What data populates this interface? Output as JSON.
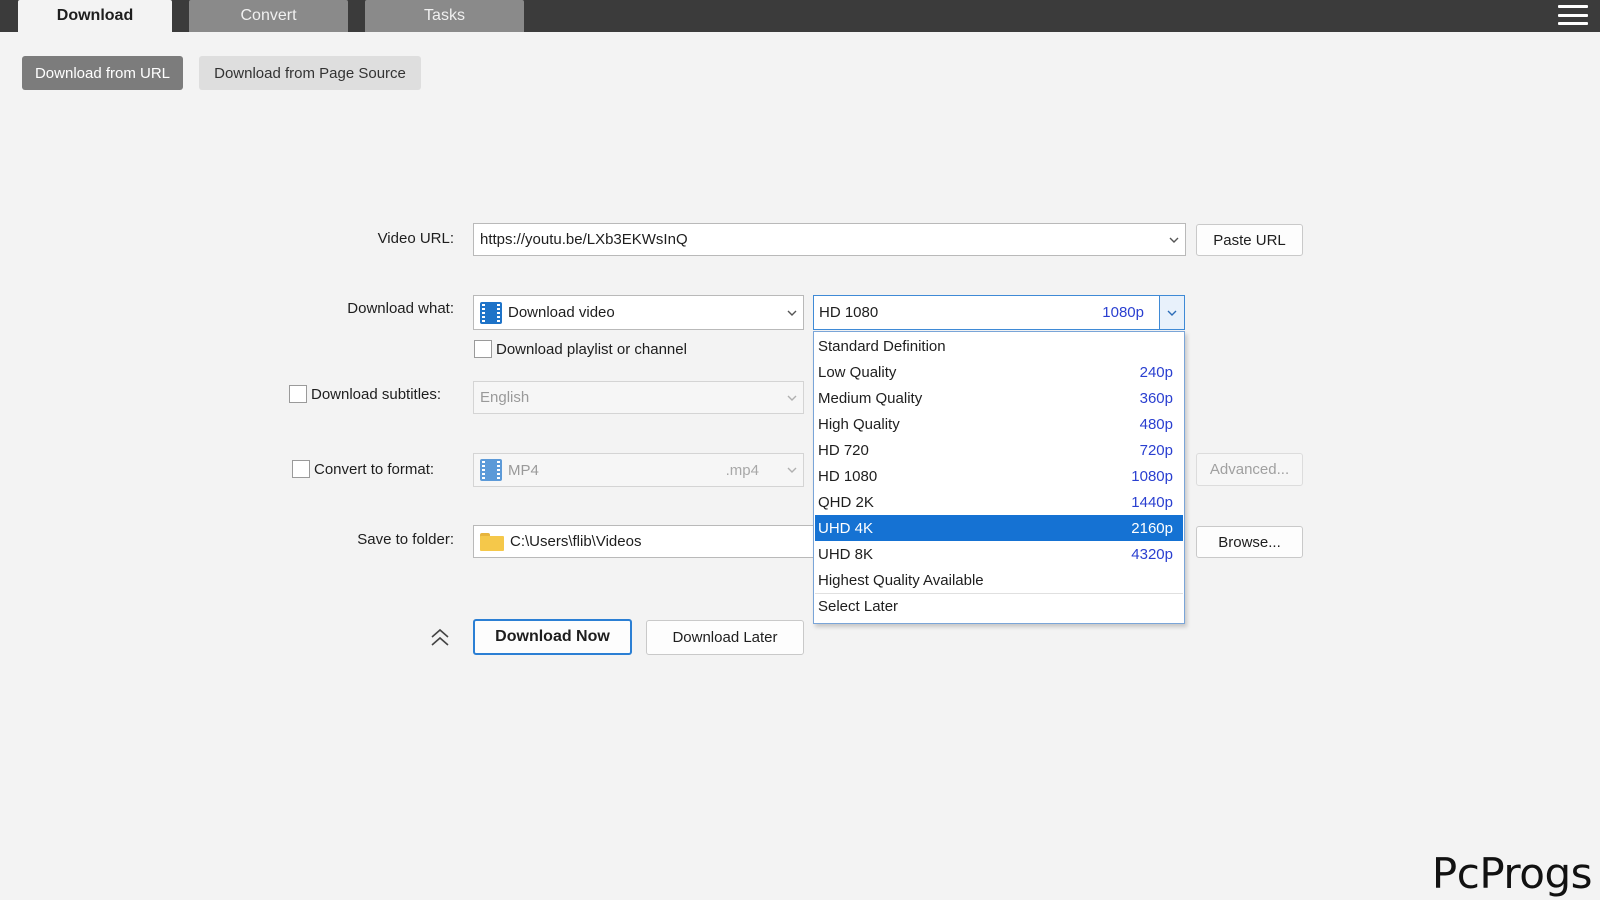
{
  "tabs": [
    {
      "label": "Download",
      "active": true
    },
    {
      "label": "Convert",
      "active": false
    },
    {
      "label": "Tasks",
      "active": false
    }
  ],
  "menu_icon": "hamburger-menu-icon",
  "source_buttons": {
    "from_url": "Download from URL",
    "from_page_source": "Download from Page Source"
  },
  "form": {
    "video_url_label": "Video URL:",
    "video_url_value": "https://youtu.be/LXb3EKWsInQ",
    "paste_url_button": "Paste URL",
    "download_what_label": "Download what:",
    "download_what_value": "Download video",
    "playlist_checkbox_label": "Download playlist or channel",
    "playlist_checked": false,
    "subtitles_label": "Download subtitles:",
    "subtitles_checked": false,
    "subtitles_language": "English",
    "convert_label": "Convert to format:",
    "convert_checked": false,
    "convert_format": "MP4",
    "convert_extension": ".mp4",
    "advanced_button": "Advanced...",
    "save_folder_label": "Save to folder:",
    "save_folder_value": "C:\\Users\\flib\\Videos",
    "browse_button": "Browse...",
    "download_now_button": "Download Now",
    "download_later_button": "Download Later"
  },
  "quality": {
    "selected_label": "HD 1080",
    "selected_res": "1080p",
    "options": [
      {
        "label": "Standard Definition",
        "res": ""
      },
      {
        "label": "Low Quality",
        "res": "240p"
      },
      {
        "label": "Medium Quality",
        "res": "360p"
      },
      {
        "label": "High Quality",
        "res": "480p"
      },
      {
        "label": "HD 720",
        "res": "720p"
      },
      {
        "label": "HD 1080",
        "res": "1080p"
      },
      {
        "label": "QHD 2K",
        "res": "1440p"
      },
      {
        "label": "UHD 4K",
        "res": "2160p",
        "highlighted": true
      },
      {
        "label": "UHD 8K",
        "res": "4320p"
      },
      {
        "label": "Highest Quality Available",
        "res": ""
      },
      {
        "label": "Select Later",
        "res": ""
      }
    ]
  },
  "colors": {
    "highlight": "#1572d3",
    "resolution_text": "#2a3fd0",
    "primary_border": "#2b7fd4",
    "tab_bar": "#3b3b3b"
  },
  "watermark": "PcProgs"
}
